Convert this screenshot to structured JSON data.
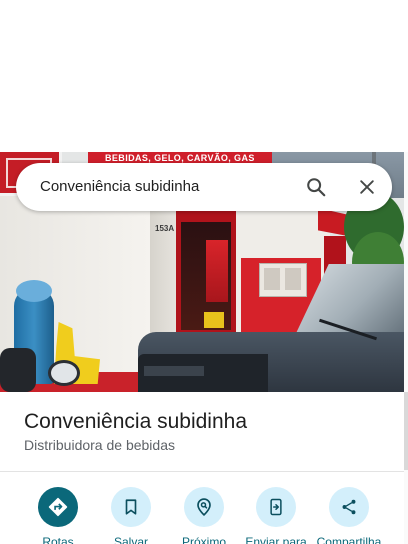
{
  "search": {
    "query": "Conveniência subidinha",
    "search_icon": "search-icon",
    "close_icon": "close-icon"
  },
  "photo": {
    "sign_text": "BEBIDAS, GELO, CARVÃO, GAS",
    "house_number": "153A"
  },
  "place": {
    "name": "Conveniência subidinha",
    "category": "Distribuidora de bebidas"
  },
  "actions": [
    {
      "label": "Rotas",
      "icon": "directions-icon"
    },
    {
      "label": "Salvar",
      "icon": "bookmark-icon"
    },
    {
      "label": "Próximo",
      "icon": "nearby-icon"
    },
    {
      "label": "Enviar para",
      "icon": "send-to-phone-icon"
    },
    {
      "label": "Compartilha",
      "icon": "share-icon"
    }
  ],
  "colors": {
    "accent": "#0b687a",
    "button_bg": "#d3effb",
    "icon": "#0b4f5e",
    "text": "#1f1f1f",
    "subtext": "#5f6368"
  }
}
